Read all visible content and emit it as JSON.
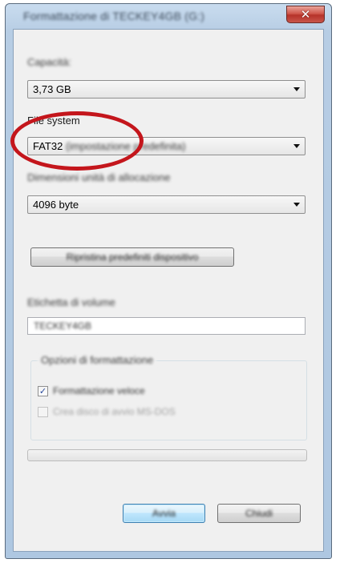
{
  "window": {
    "title": "Formattazione di TECKEY4GB (G:)",
    "close_glyph": "✕"
  },
  "capacity": {
    "label": "Capacità:",
    "value": "3,73 GB"
  },
  "file_system": {
    "label": "File system",
    "value": "FAT32",
    "value_suffix": "(impostazione predefinita)"
  },
  "allocation": {
    "label": "Dimensioni unità di allocazione",
    "value": "4096 byte"
  },
  "restore_button": {
    "label": "Ripristina predefiniti dispositivo"
  },
  "volume": {
    "label": "Etichetta di volume",
    "value": "TECKEY4GB"
  },
  "format_options": {
    "title": "Opzioni di formattazione",
    "quick_format": {
      "label": "Formattazione veloce",
      "checked": true
    },
    "ms_dos_disk": {
      "label": "Crea disco di avvio MS-DOS",
      "checked": false,
      "disabled": true
    }
  },
  "progress": {
    "value": 0
  },
  "buttons": {
    "start": "Avvia",
    "close": "Chiudi"
  },
  "colors": {
    "annotation": "#c4161c",
    "close_button": "#c8554a",
    "titlebar": "#b7cde4"
  },
  "icons": {
    "close": "close-icon",
    "dropdown": "chevron-down-icon",
    "check": "checkmark-icon"
  }
}
